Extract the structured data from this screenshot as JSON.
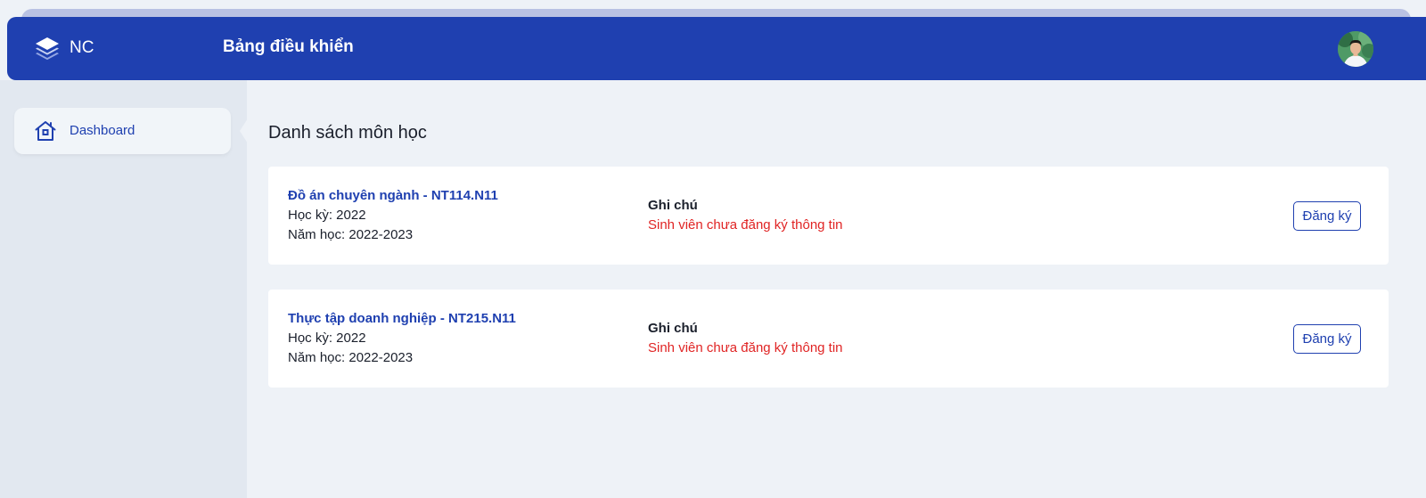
{
  "header": {
    "brand": "NC",
    "title": "Bảng điều khiển",
    "color": "#1f40b0"
  },
  "sidebar": {
    "items": [
      {
        "label": "Dashboard",
        "icon": "home-icon"
      }
    ]
  },
  "main": {
    "title": "Danh sách môn học",
    "courses": [
      {
        "name": "Đồ án chuyên ngành - NT114.N11",
        "semester": "Học kỳ: 2022",
        "year": "Năm học: 2022-2023",
        "note_title": "Ghi chú",
        "note_text": "Sinh viên chưa đăng ký thông tin",
        "button": "Đăng ký"
      },
      {
        "name": "Thực tập doanh nghiệp - NT215.N11",
        "semester": "Học kỳ: 2022",
        "year": "Năm học: 2022-2023",
        "note_title": "Ghi chú",
        "note_text": "Sinh viên chưa đăng ký thông tin",
        "button": "Đăng ký"
      }
    ]
  },
  "colors": {
    "primary": "#1f40b0",
    "warning": "#e02424",
    "sidebar_bg": "#e2e8f0",
    "page_bg": "#eef2f7"
  }
}
